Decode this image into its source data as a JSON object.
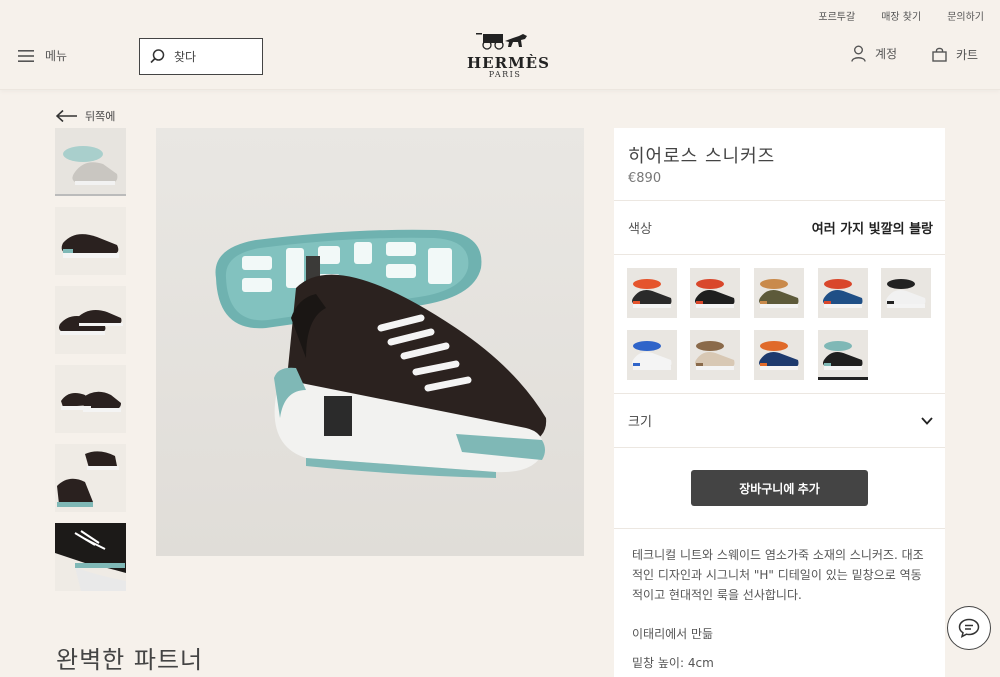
{
  "header": {
    "util_links": [
      "포르투갈",
      "매장 찾기",
      "문의하기"
    ],
    "menu_label": "메뉴",
    "search_placeholder": "찾다",
    "logo_word": "HERMÈS",
    "logo_sub": "PARIS",
    "account_label": "계정",
    "cart_label": "카트"
  },
  "nav": {
    "back_label": "뒤쪽에"
  },
  "product": {
    "title": "히어로스 스니커즈",
    "price": "€890",
    "color_label": "색상",
    "color_value": "여러 가지 빛깔의 블랑",
    "size_label": "크기",
    "add_to_cart": "장바구니에 추가",
    "description": "테크니컬 니트와 스웨이드 염소가죽 소재의 스니커즈. 대조적인 디자인과 시그니처 \"H\" 디테일이 있는 밑창으로 역동적이고 현대적인 룩을 선사합니다.",
    "origin": "이태리에서 만듦",
    "sole_height": "밑창 높이: 4cm"
  },
  "section": {
    "partner_title": "완벽한 파트너"
  },
  "swatches": [
    {
      "body": "#2a2a2a",
      "accent": "#e5542c"
    },
    {
      "body": "#1f1f1f",
      "accent": "#d9472b"
    },
    {
      "body": "#5d5a3a",
      "accent": "#c98a4b"
    },
    {
      "body": "#1f4f86",
      "accent": "#d9472b"
    },
    {
      "body": "#f1f1f1",
      "accent": "#222222"
    },
    {
      "body": "#f4f4f4",
      "accent": "#2f64c9"
    },
    {
      "body": "#d8c8b4",
      "accent": "#8a6a4a"
    },
    {
      "body": "#1d3a6e",
      "accent": "#e06a2a"
    },
    {
      "body": "#1f1f1f",
      "accent": "#7fb8b6"
    }
  ],
  "selected_swatch": 8,
  "colors": {
    "panel_bg": "#ffffff",
    "page_bg": "#f6f1eb",
    "button_bg": "#444444",
    "sole_teal": "#7fb8b6"
  }
}
